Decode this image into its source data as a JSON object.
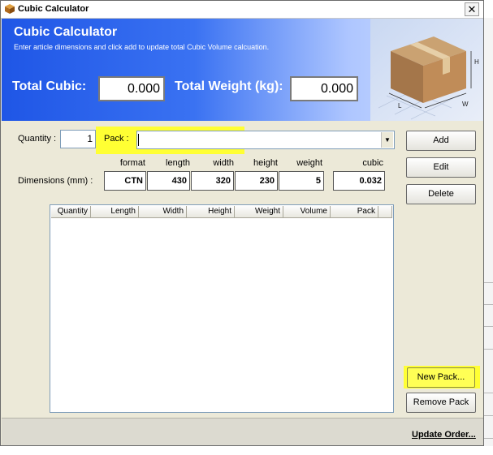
{
  "window": {
    "title": "Cubic Calculator",
    "close_glyph": "✕"
  },
  "header": {
    "title": "Cubic Calculator",
    "subtitle": "Enter article dimensions and click add to update total Cubic Volume calcuation.",
    "total_cubic_label": "Total Cubic:",
    "total_cubic_value": "0.000",
    "total_weight_label": "Total Weight (kg):",
    "total_weight_value": "0.000",
    "illustration": {
      "icon": "cardboard-box-icon",
      "dim_labels": {
        "length": "L",
        "width": "W",
        "height": "H"
      }
    }
  },
  "form": {
    "quantity_label": "Quantity :",
    "quantity_value": "1",
    "pack_label": "Pack :",
    "pack_value": "",
    "dropdown_glyph": "▼",
    "dimensions_label": "Dimensions (mm) :",
    "columns": {
      "format": "format",
      "length": "length",
      "width": "width",
      "height": "height",
      "weight": "weight",
      "cubic": "cubic"
    },
    "values": {
      "format": "CTN",
      "length": "430",
      "width": "320",
      "height": "230",
      "weight": "5",
      "cubic": "0.032"
    }
  },
  "list": {
    "columns": [
      "Quantity",
      "Length",
      "Width",
      "Height",
      "Weight",
      "Volume",
      "Pack"
    ],
    "rows": []
  },
  "buttons": {
    "add": "Add",
    "edit": "Edit",
    "delete": "Delete",
    "new_pack": "New Pack...",
    "remove_pack": "Remove Pack"
  },
  "footer": {
    "update_order": "Update Order..."
  },
  "colors": {
    "banner_blue": "#1f56e6",
    "highlight_yellow": "#ffff33",
    "dialog_bg": "#ece9d8"
  }
}
